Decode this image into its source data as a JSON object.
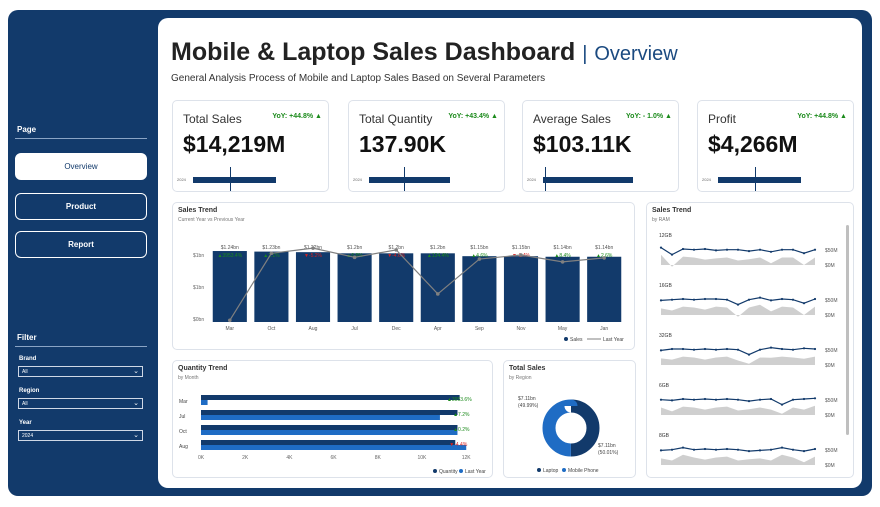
{
  "header": {
    "title": "Mobile & Laptop Sales Dashboard",
    "separator": "|",
    "page_name": "Overview",
    "subtitle": "General Analysis Process of Mobile and Laptop Sales Based on Several Parameters"
  },
  "sidebar": {
    "page_heading": "Page",
    "nav": [
      {
        "label": "Overview",
        "active": true
      },
      {
        "label": "Product",
        "active": false
      },
      {
        "label": "Report",
        "active": false
      }
    ],
    "filter_heading": "Filter",
    "filters": [
      {
        "label": "Brand",
        "value": "All"
      },
      {
        "label": "Region",
        "value": "All"
      },
      {
        "label": "Year",
        "value": "2024"
      }
    ]
  },
  "kpis": [
    {
      "label": "Total Sales",
      "value": "$14,219M",
      "yoy": "YoY: +44.8% ▲",
      "year": "2024",
      "fill": 0.72,
      "target": 0.32
    },
    {
      "label": "Total Quantity",
      "value": "137.90K",
      "yoy": "YoY: +43.4% ▲",
      "year": "2024",
      "fill": 0.7,
      "target": 0.3
    },
    {
      "label": "Average Sales",
      "value": "$103.11K",
      "yoy": "YoY: - 1.0% ▲",
      "year": "2024",
      "fill": 0.78,
      "target": 0.02
    },
    {
      "label": "Profit",
      "value": "$4,266M",
      "yoy": "YoY: +44.8% ▲",
      "year": "2024",
      "fill": 0.72,
      "target": 0.32
    }
  ],
  "sales_trend": {
    "title": "Sales Trend",
    "subtitle": "Current Year vs Previous Year"
  },
  "sales_by_ram": {
    "title": "Sales Trend",
    "subtitle": "by RAM",
    "axis_labels": [
      "$50M",
      "$0M"
    ]
  },
  "quantity_trend": {
    "title": "Quantity Trend",
    "subtitle": "by Month"
  },
  "total_sales_region": {
    "title": "Total Sales",
    "subtitle": "by Region"
  },
  "colors": {
    "navy": "#123a6b",
    "blue": "#1f6cc4",
    "gray_line": "#808080",
    "up": "#1a8a1a",
    "down": "#d42020"
  },
  "chart_data": [
    {
      "type": "bar",
      "name": "sales_trend",
      "categories": [
        "Mar",
        "Oct",
        "Aug",
        "Jul",
        "Dec",
        "Apr",
        "Sep",
        "Nov",
        "May",
        "Jan"
      ],
      "series": [
        {
          "name": "Sales",
          "values": [
            1.24,
            1.23,
            1.22,
            1.2,
            1.2,
            1.2,
            1.15,
            1.15,
            1.14,
            1.14
          ]
        },
        {
          "name": "Last Year",
          "values": [
            0.03,
            1.2,
            1.29,
            1.13,
            1.26,
            0.49,
            1.1,
            1.17,
            1.05,
            1.12
          ]
        }
      ],
      "data_labels": [
        "$1.24bn",
        "$1.23bn",
        "$1.22bn",
        "$1.2bn",
        "$1.2bn",
        "$1.2bn",
        "$1.15bn",
        "$1.15bn",
        "$1.14bn",
        "$1.14bn"
      ],
      "change_labels": [
        "▲3953.4%",
        "▲2.1%",
        "▼-5.2%",
        "▲6.6%",
        "▼-4.6%",
        "▲134.4%",
        "▲4.6%",
        "▼-1.4%",
        "▲8.4%",
        "▲2.6%"
      ],
      "change_up": [
        true,
        true,
        false,
        true,
        false,
        true,
        true,
        false,
        true,
        true
      ],
      "ytick_labels": [
        "$1bn",
        "$1bn",
        "$0bn"
      ],
      "ylim": [
        0,
        1.45
      ],
      "legend": [
        "Sales",
        "Last Year"
      ]
    },
    {
      "type": "bar",
      "name": "quantity_trend",
      "orientation": "horizontal",
      "categories": [
        "Mar",
        "Jul",
        "Oct",
        "Aug"
      ],
      "series": [
        {
          "name": "Quantity",
          "values": [
            11.8,
            11.7,
            11.7,
            11.6
          ]
        },
        {
          "name": "Last Year",
          "values": [
            0.3,
            10.9,
            11.7,
            12.1
          ]
        }
      ],
      "change_labels": [
        "▲3953.6%",
        "▲7.2%",
        "▲0.2%",
        "▼-4.4%"
      ],
      "change_up": [
        true,
        true,
        true,
        false
      ],
      "xticks": [
        "0K",
        "2K",
        "4K",
        "6K",
        "8K",
        "10K",
        "12K"
      ],
      "xlim": [
        0,
        12.5
      ],
      "legend": [
        "Quantity",
        "Last Year"
      ]
    },
    {
      "type": "pie",
      "name": "total_sales_region",
      "categories": [
        "Laptop",
        "Mobile Phone"
      ],
      "values": [
        49.99,
        50.01
      ],
      "slice_labels": [
        {
          "value": "$7.11bn",
          "pct": "(49.99%)"
        },
        {
          "value": "$7.11bn",
          "pct": "(50.01%)"
        }
      ],
      "legend": [
        "Laptop",
        "Mobile Phone"
      ]
    },
    {
      "type": "area",
      "name": "sales_by_ram",
      "series": [
        {
          "name": "12GB",
          "values": [
            58,
            48,
            56,
            55,
            56,
            54,
            55,
            55,
            53,
            55,
            52,
            55,
            55,
            50,
            55
          ]
        },
        {
          "name": "16GB",
          "values": [
            54,
            55,
            56,
            55,
            56,
            56,
            55,
            48,
            55,
            58,
            54,
            56,
            55,
            50,
            56
          ]
        },
        {
          "name": "32GB",
          "values": [
            54,
            56,
            56,
            55,
            56,
            55,
            56,
            55,
            48,
            55,
            58,
            56,
            55,
            57,
            56
          ]
        },
        {
          "name": "6GB",
          "values": [
            55,
            54,
            56,
            55,
            56,
            55,
            56,
            55,
            53,
            55,
            56,
            48,
            55,
            56,
            57
          ]
        },
        {
          "name": "8GB",
          "values": [
            54,
            55,
            58,
            55,
            56,
            55,
            56,
            55,
            53,
            54,
            55,
            58,
            55,
            53,
            56
          ]
        }
      ]
    }
  ]
}
